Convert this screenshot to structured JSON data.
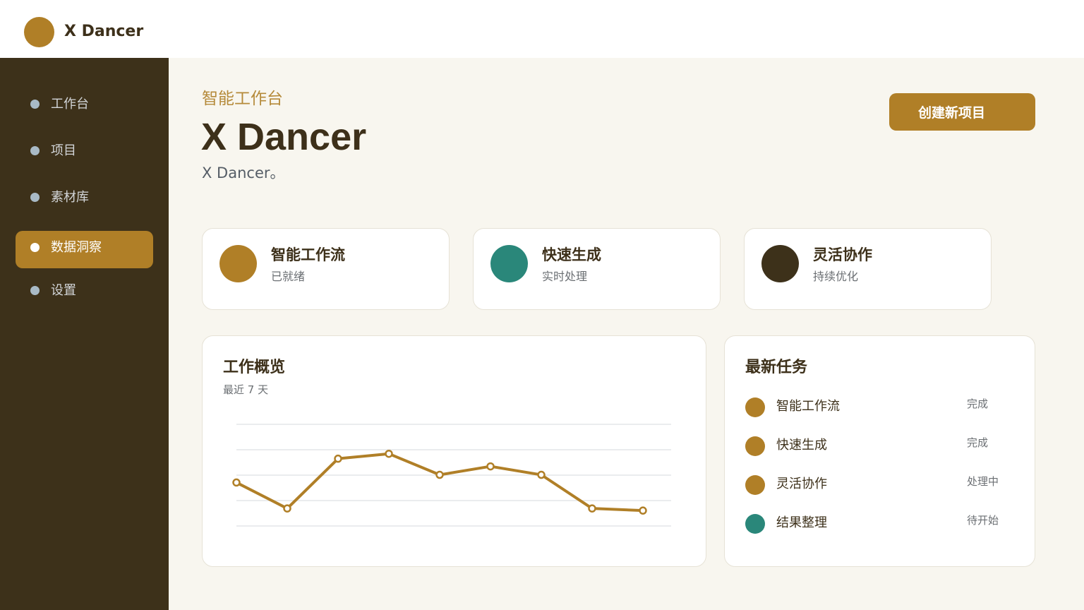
{
  "app": {
    "name": "X Dancer"
  },
  "colors": {
    "accent": "#b07f27",
    "teal": "#2a877a",
    "dark": "#3d311a"
  },
  "sidebar": {
    "items": [
      {
        "label": "工作台",
        "active": false
      },
      {
        "label": "项目",
        "active": false
      },
      {
        "label": "素材库",
        "active": false
      },
      {
        "label": "数据洞察",
        "active": true
      },
      {
        "label": "设置",
        "active": false
      }
    ]
  },
  "header": {
    "eyebrow": "智能工作台",
    "title": "X Dancer",
    "subtitle": "X Dancer。",
    "create_button": "创建新项目"
  },
  "stats": [
    {
      "title": "智能工作流",
      "sub": "已就绪",
      "color": "#b07f27"
    },
    {
      "title": "快速生成",
      "sub": "实时处理",
      "color": "#2a877a"
    },
    {
      "title": "灵活协作",
      "sub": "持续优化",
      "color": "#3d311a"
    }
  ],
  "overview": {
    "title": "工作概览",
    "subtitle": "最近 7 天"
  },
  "chart_data": {
    "type": "line",
    "x": [
      1,
      2,
      3,
      4,
      5,
      6,
      7,
      8,
      9
    ],
    "series": [
      {
        "values": [
          62,
          25,
          96,
          103,
          73,
          85,
          73,
          25,
          22
        ]
      }
    ],
    "ylim": [
      0,
      145
    ],
    "grid": true,
    "color": "#b07f27"
  },
  "tasks": {
    "title": "最新任务",
    "items": [
      {
        "name": "智能工作流",
        "status": "完成",
        "color": "#b07f27"
      },
      {
        "name": "快速生成",
        "status": "完成",
        "color": "#b07f27"
      },
      {
        "name": "灵活协作",
        "status": "处理中",
        "color": "#b07f27"
      },
      {
        "name": "结果整理",
        "status": "待开始",
        "color": "#2a877a"
      }
    ]
  }
}
